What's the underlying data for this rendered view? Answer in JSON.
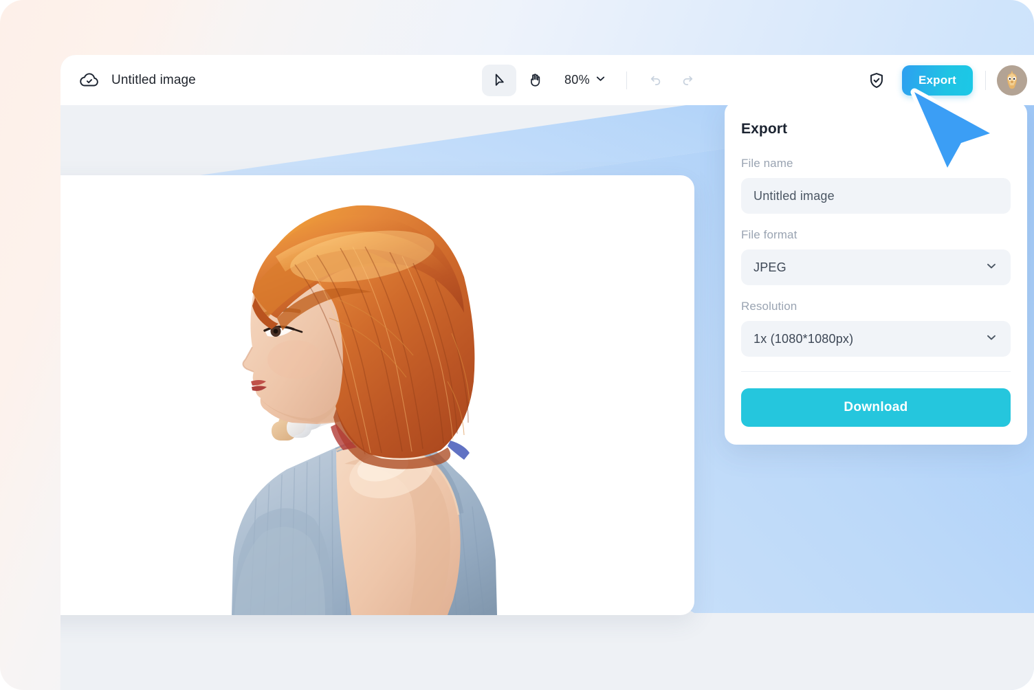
{
  "app": {
    "document_title": "Untitled image",
    "cloud_status_icon": "cloud-check-icon"
  },
  "toolbar": {
    "select_tool_icon": "cursor-arrow-icon",
    "hand_tool_icon": "hand-icon",
    "zoom_level": "80%",
    "zoom_chevron_icon": "chevron-down-icon",
    "undo_icon": "undo-arrow-icon",
    "redo_icon": "redo-arrow-icon",
    "shield_icon": "shield-check-icon",
    "export_label": "Export",
    "avatar_icon": "user-avatar"
  },
  "export_panel": {
    "title": "Export",
    "file_name_label": "File name",
    "file_name_value": "Untitled image",
    "file_format_label": "File format",
    "file_format_value": "JPEG",
    "file_format_chevron": "chevron-down-icon",
    "resolution_label": "Resolution",
    "resolution_value": "1x (1080*1080px)",
    "resolution_chevron": "chevron-down-icon",
    "download_label": "Download"
  },
  "canvas": {
    "image_alt": "profile portrait of woman with red bob haircut wearing grey tank top and white headphones"
  },
  "colors": {
    "export_gradient_start": "#2e9ff0",
    "export_gradient_end": "#1cc8e6",
    "download_button": "#25c6dd",
    "cursor_blue": "#3b9ef5",
    "beam_blue": "#a9cefa",
    "app_canvas_bg": "#eef1f5",
    "field_bg": "#f1f4f8",
    "text_dark": "#21262e",
    "label_grey": "#9aa4b2"
  }
}
